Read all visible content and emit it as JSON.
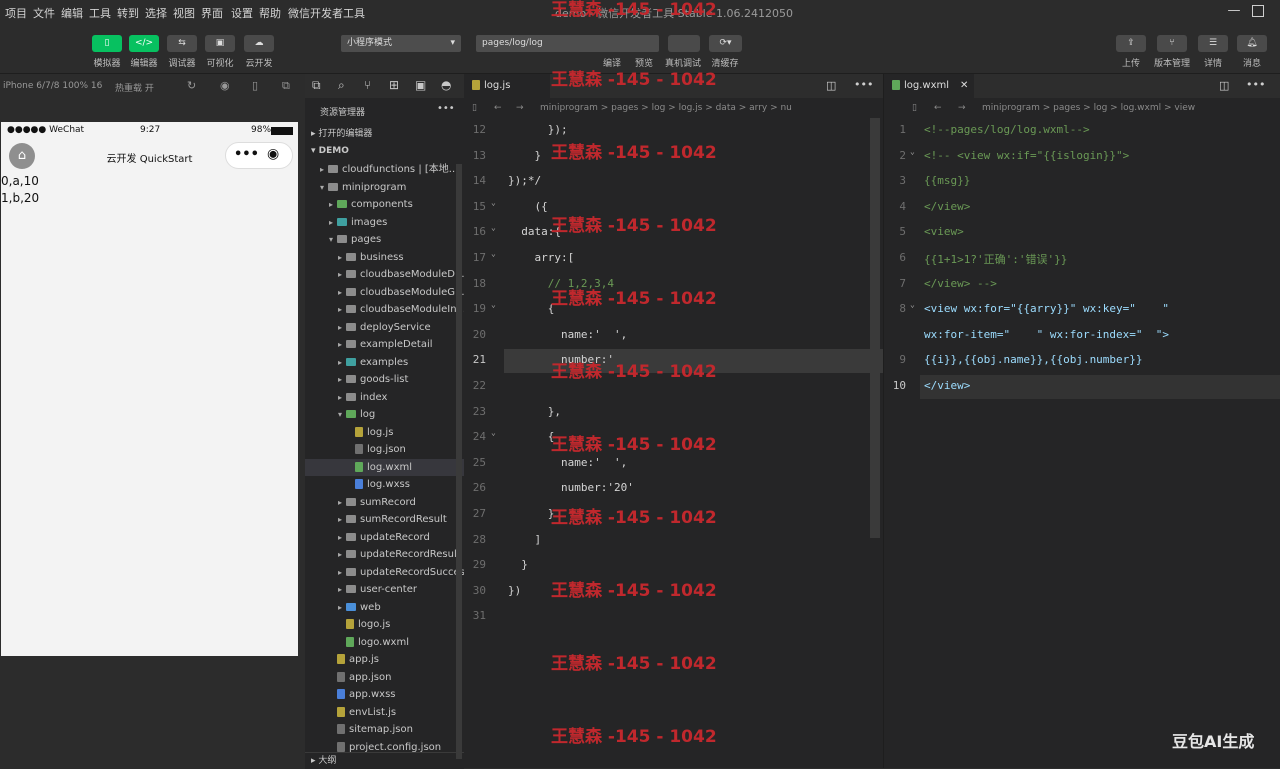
{
  "menu": [
    "项目",
    "文件",
    "编辑",
    "工具",
    "转到",
    "选择",
    "视图",
    "界面",
    "设置",
    "帮助",
    "微信开发者工具"
  ],
  "window_title": "demo - 微信开发者工具 Stable 1.06.2412050",
  "toolbar": {
    "left_buttons": [
      "模拟器",
      "编辑器",
      "调试器",
      "可视化",
      "云开发"
    ],
    "mode_select": "小程序模式",
    "path_select": "pages/log/log",
    "mid_buttons": [
      "编译",
      "预览",
      "真机调试",
      "清缓存"
    ],
    "right_buttons": [
      "上传",
      "版本管理",
      "详情",
      "消息"
    ]
  },
  "simulator": {
    "device": "iPhone 6/7/8 100% 16",
    "hotreload": "热重载 开",
    "status_left": "●●●●● WeChat",
    "status_time": "9:27",
    "status_battery": "98%",
    "nav_title": "云开发 QuickStart",
    "output_lines": [
      "0,a,10",
      "1,b,20"
    ]
  },
  "explorer": {
    "title": "资源管理器",
    "section_open": "打开的编辑器",
    "section_root": "DEMO",
    "section_outline": "大纲",
    "items": [
      {
        "label": "cloudfunctions | [本地...",
        "icon": "folder",
        "indent": 1,
        "arrow": "▸"
      },
      {
        "label": "miniprogram",
        "icon": "folder",
        "indent": 1,
        "arrow": "▾"
      },
      {
        "label": "components",
        "icon": "folder-g",
        "indent": 2,
        "arrow": "▸"
      },
      {
        "label": "images",
        "icon": "folder-t",
        "indent": 2,
        "arrow": "▸"
      },
      {
        "label": "pages",
        "icon": "folder",
        "indent": 2,
        "arrow": "▾"
      },
      {
        "label": "business",
        "icon": "folder",
        "indent": 3,
        "arrow": "▸"
      },
      {
        "label": "cloudbaseModuleD...",
        "icon": "folder",
        "indent": 3,
        "arrow": "▸"
      },
      {
        "label": "cloudbaseModuleG...",
        "icon": "folder",
        "indent": 3,
        "arrow": "▸"
      },
      {
        "label": "cloudbaseModuleIn...",
        "icon": "folder",
        "indent": 3,
        "arrow": "▸"
      },
      {
        "label": "deployService",
        "icon": "folder",
        "indent": 3,
        "arrow": "▸"
      },
      {
        "label": "exampleDetail",
        "icon": "folder",
        "indent": 3,
        "arrow": "▸"
      },
      {
        "label": "examples",
        "icon": "folder-t",
        "indent": 3,
        "arrow": "▸"
      },
      {
        "label": "goods-list",
        "icon": "folder",
        "indent": 3,
        "arrow": "▸"
      },
      {
        "label": "index",
        "icon": "folder",
        "indent": 3,
        "arrow": "▸"
      },
      {
        "label": "log",
        "icon": "folder-g",
        "indent": 3,
        "arrow": "▾"
      },
      {
        "label": "log.js",
        "icon": "js",
        "indent": 4,
        "arrow": ""
      },
      {
        "label": "log.json",
        "icon": "json",
        "indent": 4,
        "arrow": ""
      },
      {
        "label": "log.wxml",
        "icon": "wxml",
        "indent": 4,
        "arrow": "",
        "selected": true
      },
      {
        "label": "log.wxss",
        "icon": "wxss",
        "indent": 4,
        "arrow": ""
      },
      {
        "label": "sumRecord",
        "icon": "folder",
        "indent": 3,
        "arrow": "▸"
      },
      {
        "label": "sumRecordResult",
        "icon": "folder",
        "indent": 3,
        "arrow": "▸"
      },
      {
        "label": "updateRecord",
        "icon": "folder",
        "indent": 3,
        "arrow": "▸"
      },
      {
        "label": "updateRecordResult",
        "icon": "folder",
        "indent": 3,
        "arrow": "▸"
      },
      {
        "label": "updateRecordSuccess",
        "icon": "folder",
        "indent": 3,
        "arrow": "▸"
      },
      {
        "label": "user-center",
        "icon": "folder",
        "indent": 3,
        "arrow": "▸"
      },
      {
        "label": "web",
        "icon": "folder-b",
        "indent": 3,
        "arrow": "▸"
      },
      {
        "label": "logo.js",
        "icon": "js",
        "indent": 3,
        "arrow": ""
      },
      {
        "label": "logo.wxml",
        "icon": "wxml",
        "indent": 3,
        "arrow": ""
      },
      {
        "label": "app.js",
        "icon": "js",
        "indent": 2,
        "arrow": ""
      },
      {
        "label": "app.json",
        "icon": "json",
        "indent": 2,
        "arrow": ""
      },
      {
        "label": "app.wxss",
        "icon": "wxss",
        "indent": 2,
        "arrow": ""
      },
      {
        "label": "envList.js",
        "icon": "js",
        "indent": 2,
        "arrow": ""
      },
      {
        "label": "sitemap.json",
        "icon": "json",
        "indent": 2,
        "arrow": ""
      },
      {
        "label": "project.config.json",
        "icon": "json",
        "indent": 2,
        "arrow": ""
      }
    ]
  },
  "editor1": {
    "tab": "log.js",
    "breadcrumb": "miniprogram > pages > log > log.js > data > arry > nu",
    "lines": [
      {
        "n": "12",
        "t": "      });"
      },
      {
        "n": "13",
        "t": "    }"
      },
      {
        "n": "14",
        "t": "});*/"
      },
      {
        "n": "15",
        "t": "    ({"
      },
      {
        "n": "16",
        "t": "  data:{"
      },
      {
        "n": "17",
        "t": "    arry:["
      },
      {
        "n": "18",
        "t": "      // 1,2,3,4",
        "comment": true
      },
      {
        "n": "19",
        "t": "      {"
      },
      {
        "n": "20",
        "t": "        name:'  ',"
      },
      {
        "n": "21",
        "t": "        number:'",
        "current": true
      },
      {
        "n": "22",
        "t": ""
      },
      {
        "n": "23",
        "t": "      },"
      },
      {
        "n": "24",
        "t": "      {"
      },
      {
        "n": "25",
        "t": "        name:'  ',"
      },
      {
        "n": "26",
        "t": "        number:'20'"
      },
      {
        "n": "27",
        "t": "      }"
      },
      {
        "n": "28",
        "t": "    ]"
      },
      {
        "n": "29",
        "t": "  }"
      },
      {
        "n": "30",
        "t": "})"
      },
      {
        "n": "31",
        "t": ""
      }
    ]
  },
  "editor2": {
    "tab": "log.wxml",
    "breadcrumb": "miniprogram > pages > log > log.wxml > view",
    "lines": [
      {
        "n": "1",
        "t": "<!--pages/log/log.wxml-->",
        "comment": true
      },
      {
        "n": "2",
        "t": "<!-- <view wx:if=\"{{islogin}}\">",
        "comment": true
      },
      {
        "n": "3",
        "t": "{{msg}}",
        "comment": true
      },
      {
        "n": "4",
        "t": "</view>",
        "comment": true
      },
      {
        "n": "5",
        "t": "<view>",
        "comment": true
      },
      {
        "n": "6",
        "t": "{{1+1>1?'正确':'错误'}}",
        "comment": true
      },
      {
        "n": "7",
        "t": "</view> -->",
        "comment": true
      },
      {
        "n": "8",
        "t": "<view wx:for=\"{{arry}}\" wx:key=\"    \""
      },
      {
        "n": "",
        "t": "wx:for-item=\"    \" wx:for-index=\"  \">"
      },
      {
        "n": "9",
        "t": "{{i}},{{obj.name}},{{obj.number}}"
      },
      {
        "n": "10",
        "t": "</view>",
        "current": true
      }
    ]
  },
  "watermark": "王慧森 -145 - 1042",
  "corner_logo": "豆包AI生成"
}
